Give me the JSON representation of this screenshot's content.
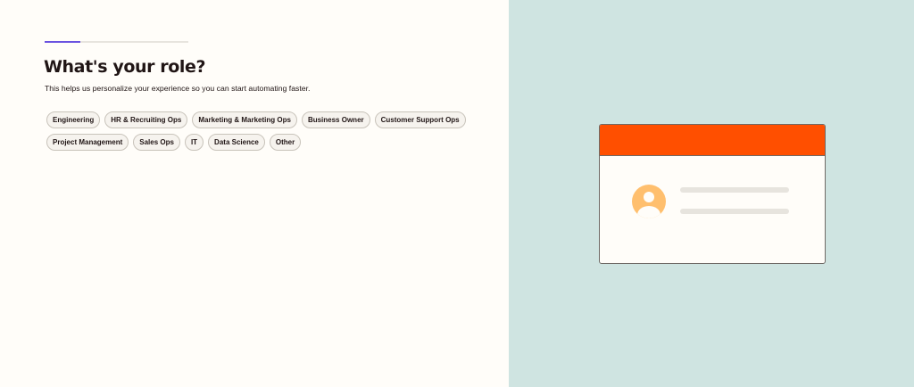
{
  "progress": {
    "fraction": 0.25,
    "fill_color": "#6a52e0"
  },
  "title": "What's your role?",
  "subtitle": "This helps us personalize your experience so you can start automating faster.",
  "roles": [
    {
      "label": "Engineering",
      "name": "role-chip-engineering"
    },
    {
      "label": "HR & Recruiting Ops",
      "name": "role-chip-hr-recruiting-ops"
    },
    {
      "label": "Marketing & Marketing Ops",
      "name": "role-chip-marketing-ops"
    },
    {
      "label": "Business Owner",
      "name": "role-chip-business-owner"
    },
    {
      "label": "Customer Support Ops",
      "name": "role-chip-customer-support-ops"
    },
    {
      "label": "Project Management",
      "name": "role-chip-project-management"
    },
    {
      "label": "Sales Ops",
      "name": "role-chip-sales-ops"
    },
    {
      "label": "IT",
      "name": "role-chip-it"
    },
    {
      "label": "Data Science",
      "name": "role-chip-data-science"
    },
    {
      "label": "Other",
      "name": "role-chip-other"
    }
  ],
  "illustration": {
    "header_color": "#ff4f00",
    "avatar_color": "#ffbf6e",
    "panel_background": "#cfe4e1",
    "avatar_icon": "user-avatar-icon"
  }
}
